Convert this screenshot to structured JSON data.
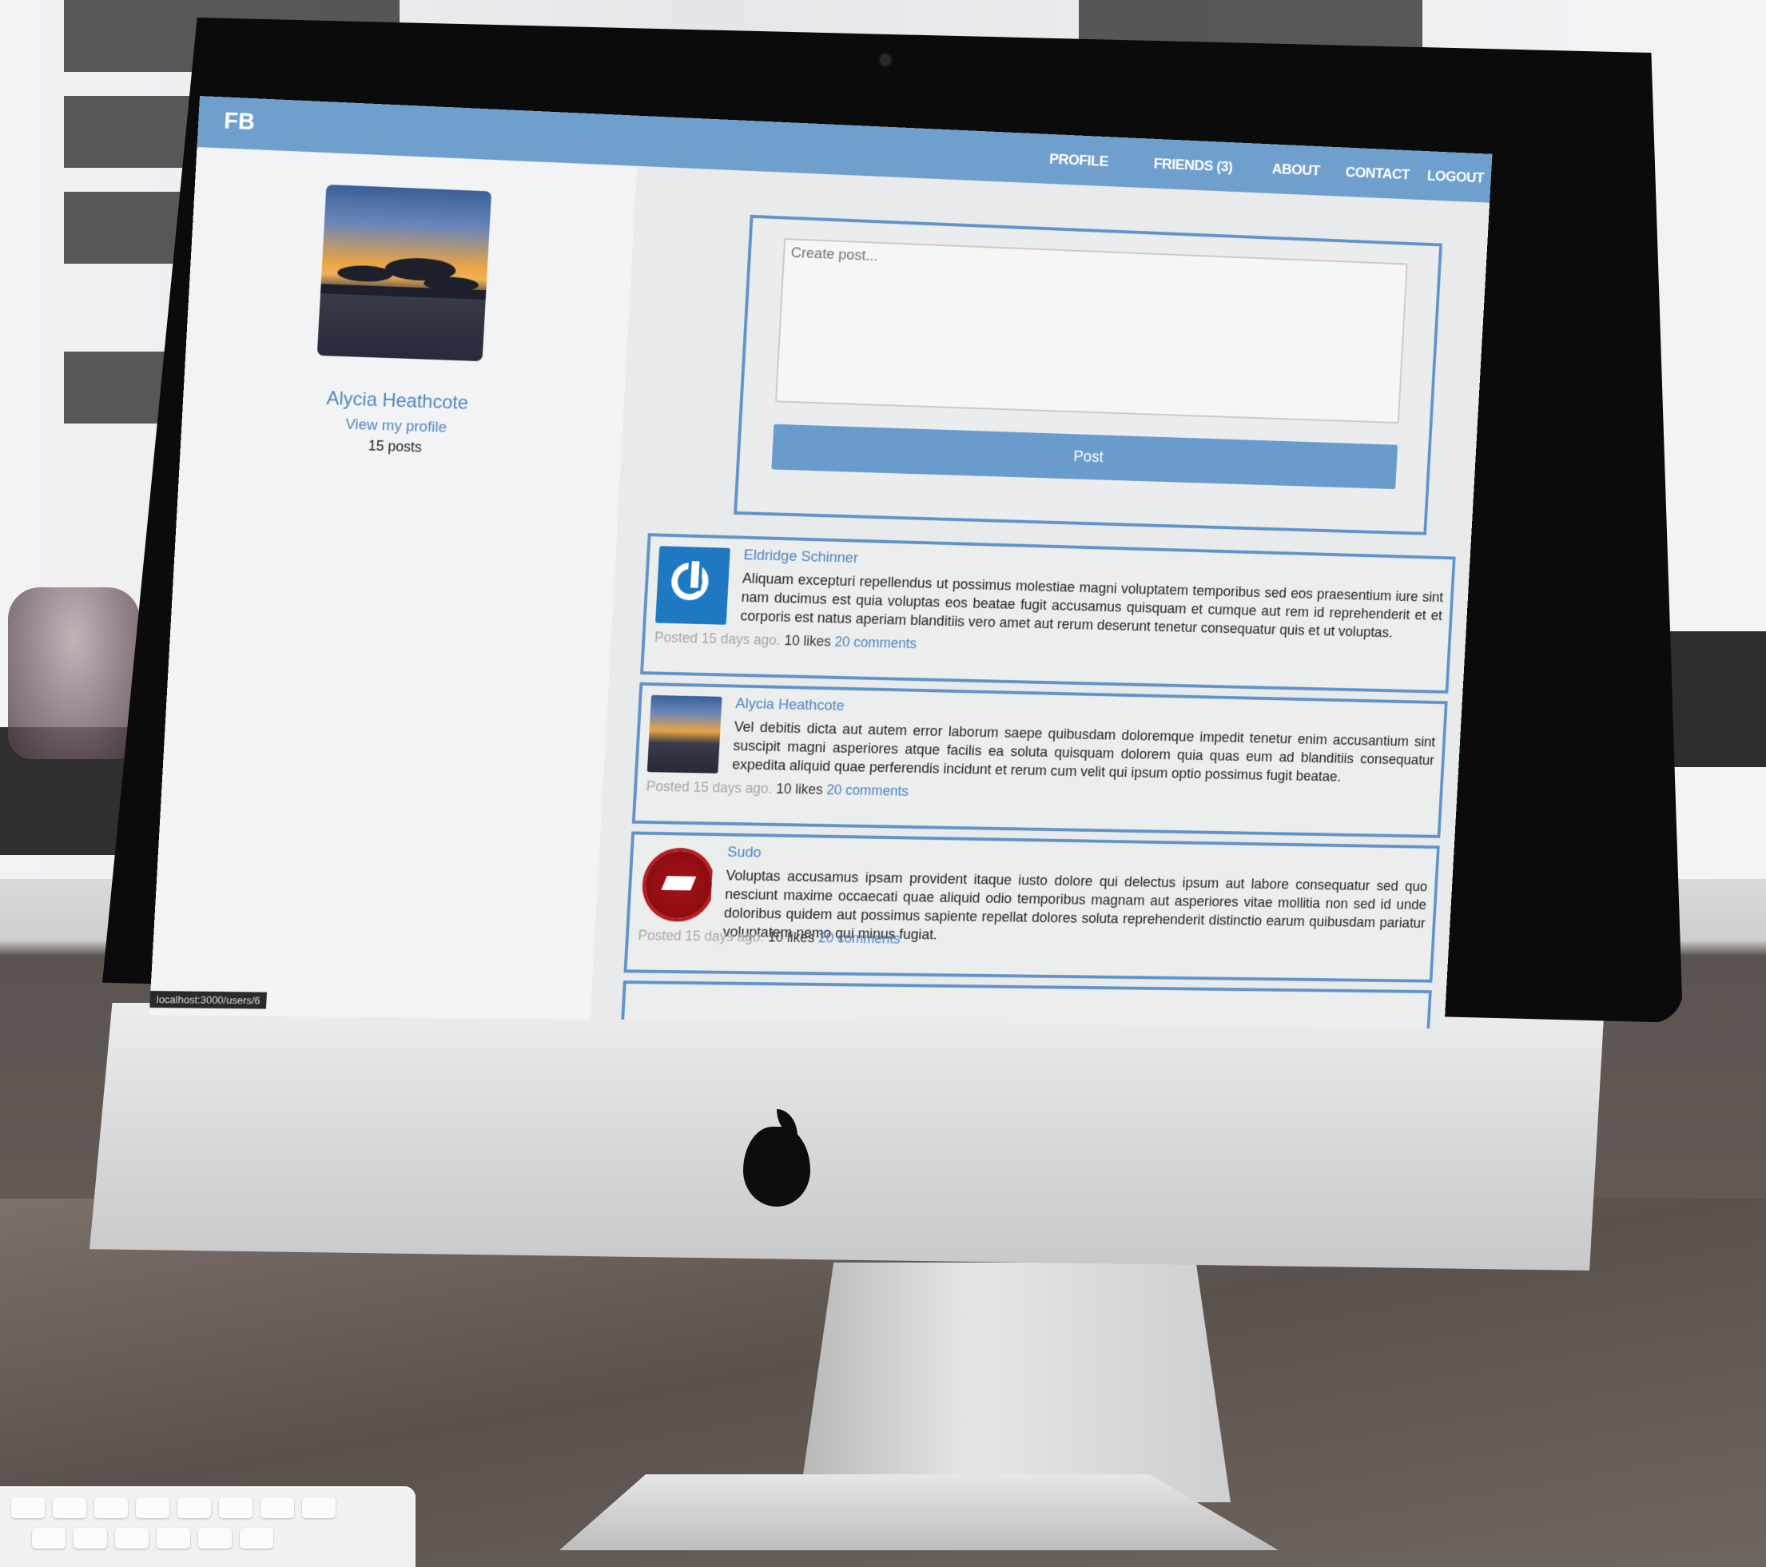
{
  "app": {
    "brand": "FB"
  },
  "nav": {
    "profile": "PROFILE",
    "friends": "FRIENDS (3)",
    "about": "ABOUT",
    "contact": "CONTACT",
    "logout": "LOGOUT"
  },
  "sidebar": {
    "name": "Alycia Heathcote",
    "view_profile": "View my profile",
    "post_count": "15 posts"
  },
  "composer": {
    "placeholder": "Create post...",
    "button": "Post"
  },
  "posts": [
    {
      "author": "Eldridge Schinner",
      "avatar_icon": "power-icon",
      "body": "Aliquam excepturi repellendus ut possimus molestiae magni voluptatem temporibus sed eos praesentium iure sint nam ducimus est quia voluptas eos beatae fugit accusamus quisquam et cumque aut rem id reprehenderit et et corporis est natus aperiam blanditiis vero amet aut rerum deserunt tenetur consequatur quis et ut voluptas.",
      "posted": "Posted 15 days ago.",
      "likes": "10 likes",
      "comments": "20 comments"
    },
    {
      "author": "Alycia Heathcote",
      "avatar_icon": "sunset-photo",
      "body": "Vel debitis dicta aut autem error laborum saepe quibusdam doloremque impedit tenetur enim accusantium sint suscipit magni asperiores atque facilis ea soluta quisquam dolorem quia quas eum ad blanditiis consequatur expedita aliquid quae perferendis incidunt et rerum cum velit qui ipsum optio possimus fugit beatae.",
      "posted": "Posted 15 days ago.",
      "likes": "10 likes",
      "comments": "20 comments"
    },
    {
      "author": "Sudo",
      "avatar_icon": "graduation-seal-icon",
      "body": "Voluptas accusamus ipsam provident itaque iusto dolore qui delectus ipsum aut labore consequatur sed quo nesciunt maxime occaecati quae aliquid odio temporibus magnam aut asperiores vitae mollitia non sed id unde doloribus quidem aut possimus sapiente repellat dolores soluta reprehenderit distinctio earum quibusdam pariatur voluptatem nemo qui minus fugiat.",
      "posted": "Posted 15 days ago.",
      "likes": "10 likes",
      "comments": "20 comments"
    }
  ],
  "status_bar": {
    "url": "localhost:3000/users/6"
  },
  "colors": {
    "accent": "#6f9fcd",
    "link": "#4f86c0",
    "border": "#5f93c9"
  }
}
